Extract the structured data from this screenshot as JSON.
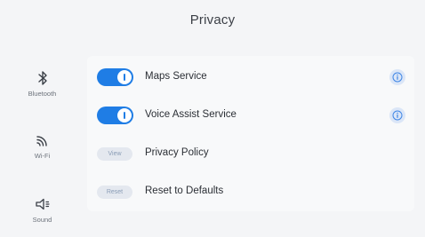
{
  "header": {
    "title": "Privacy"
  },
  "sidebar": {
    "items": [
      {
        "label": "Bluetooth",
        "icon": "bluetooth-icon"
      },
      {
        "label": "Wi-Fi",
        "icon": "wifi-icon"
      },
      {
        "label": "Sound",
        "icon": "speaker-icon"
      }
    ]
  },
  "settings": {
    "maps": {
      "label": "Maps Service",
      "enabled": true
    },
    "voice": {
      "label": "Voice Assist Service",
      "enabled": true
    },
    "policy": {
      "label": "Privacy Policy",
      "button": "View"
    },
    "reset": {
      "label": "Reset to Defaults",
      "button": "Reset"
    }
  },
  "colors": {
    "accent": "#1f7de5",
    "background": "#f4f5f7",
    "panel": "#f8f9fa",
    "pill": "#e4e8ef"
  }
}
